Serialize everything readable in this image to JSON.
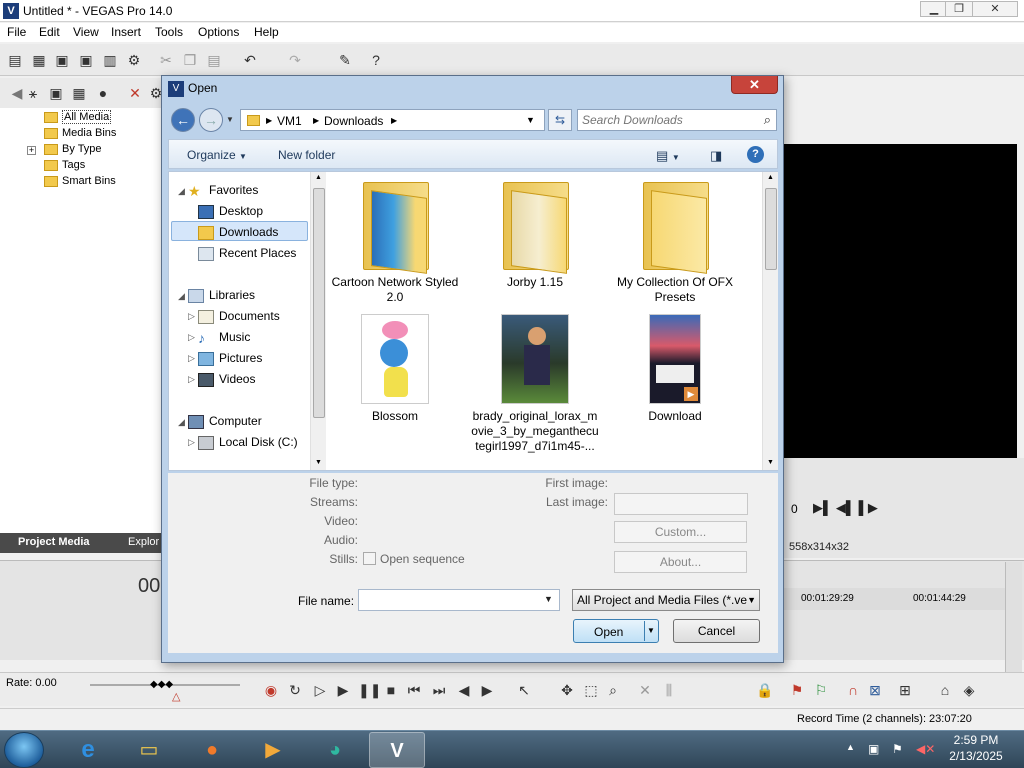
{
  "app": {
    "title": "Untitled * - VEGAS Pro 14.0",
    "logo": "V",
    "menu": [
      "File",
      "Edit",
      "View",
      "Insert",
      "Tools",
      "Options",
      "Help"
    ],
    "media_tree": [
      "All Media",
      "Media Bins",
      "By Type",
      "Tags",
      "Smart Bins"
    ],
    "tree_expand": "+",
    "project_tabs": [
      "Project Media",
      "Explor"
    ],
    "preview_info": "558x314x32",
    "preview_zero": "0",
    "time_display": "00",
    "ruler_marks": [
      "00:01:29:29",
      "00:01:44:29"
    ],
    "rate": "Rate: 0.00",
    "status_record": "Record Time (2 channels): 23:07:20"
  },
  "dialog": {
    "title": "Open",
    "close_glyph": "✕",
    "address": [
      "VM1",
      "Downloads"
    ],
    "search_placeholder": "Search Downloads",
    "organize": "Organize",
    "new_folder": "New folder",
    "nav": {
      "favorites": "Favorites",
      "desktop": "Desktop",
      "downloads": "Downloads",
      "recent": "Recent Places",
      "libraries": "Libraries",
      "documents": "Documents",
      "music": "Music",
      "pictures": "Pictures",
      "videos": "Videos",
      "computer": "Computer",
      "local_disk": "Local Disk (C:)"
    },
    "files": [
      {
        "name": "Cartoon Network Styled 2.0",
        "kind": "folder"
      },
      {
        "name": "Jorby 1.15",
        "kind": "folder"
      },
      {
        "name": "My Collection Of OFX Presets",
        "kind": "folder"
      },
      {
        "name": "Blossom",
        "kind": "image"
      },
      {
        "name": "brady_original_lorax_movie_3_by_meganthecutegirl1997_d7i1m45-...",
        "kind": "image"
      },
      {
        "name": "Download",
        "kind": "video"
      }
    ],
    "details": {
      "file_type": "File type:",
      "streams": "Streams:",
      "video": "Video:",
      "audio": "Audio:",
      "stills": "Stills:",
      "open_sequence": "Open sequence",
      "first_image": "First image:",
      "last_image": "Last image:",
      "custom": "Custom...",
      "about": "About..."
    },
    "file_name_label": "File name:",
    "file_name_value": "",
    "file_type_filter": "All Project and Media Files (*.ve",
    "open_button": "Open",
    "cancel_button": "Cancel"
  },
  "taskbar": {
    "time": "2:59 PM",
    "date": "2/13/2025"
  }
}
